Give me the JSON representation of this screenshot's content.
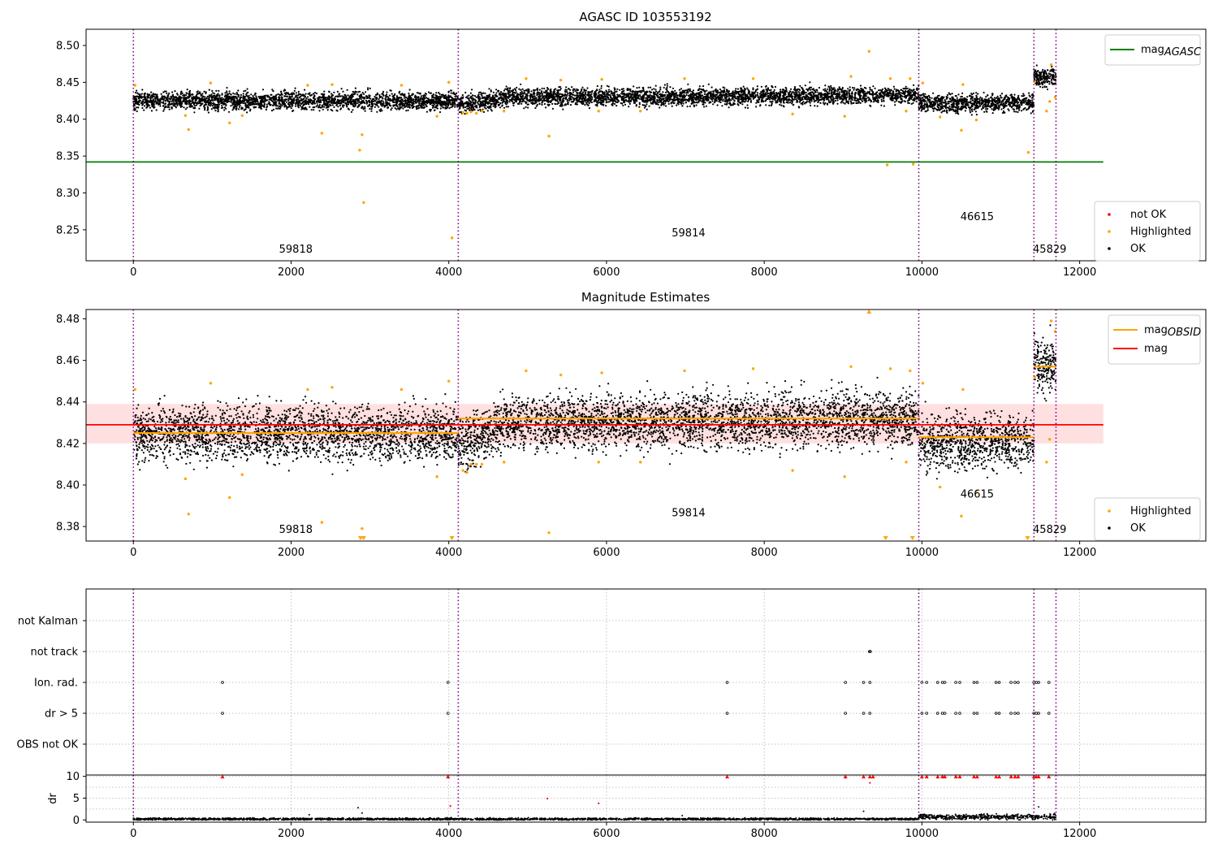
{
  "chart_data": [
    {
      "type": "scatter",
      "title": "AGASC ID 103553192",
      "xlim": [
        -600,
        13600
      ],
      "ylim": [
        8.208,
        8.522
      ],
      "xticks": [
        "0",
        "2000",
        "4000",
        "6000",
        "8000",
        "10000",
        "12000"
      ],
      "yticks": [
        "8.25",
        "8.30",
        "8.35",
        "8.40",
        "8.45",
        "8.50"
      ],
      "grid": false,
      "legend_top": {
        "placement": "top-right",
        "entries": [
          {
            "name": "mag",
            "sub": "AGASC",
            "color": "#008000"
          }
        ]
      },
      "legend_bottom": {
        "placement": "bottom-right",
        "entries": [
          {
            "name": "not OK",
            "color": "#ff0000"
          },
          {
            "name": "Highlighted",
            "color": "#ffa500"
          },
          {
            "name": "OK",
            "color": "#000000"
          }
        ]
      },
      "obsid_boundaries": [
        0,
        4120,
        9960,
        11420,
        11700
      ],
      "obsid_labels": [
        {
          "text": "59818",
          "x": 2060,
          "y": 8.219
        },
        {
          "text": "59814",
          "x": 7040,
          "y": 8.241
        },
        {
          "text": "46615",
          "x": 10700,
          "y": 8.263
        },
        {
          "text": "45829",
          "x": 11620,
          "y": 8.219
        }
      ],
      "mag_agasc": {
        "value": 8.342,
        "x_range": [
          -600,
          12300
        ]
      },
      "ok_segments": [
        {
          "x0": 0,
          "x1": 4120,
          "center": 8.425,
          "spread": 0.006,
          "slope": 0
        },
        {
          "x0": 4120,
          "x1": 4600,
          "center": 8.423,
          "spread": 0.006,
          "slope": 0.006
        },
        {
          "x0": 4600,
          "x1": 9960,
          "center": 8.431,
          "spread": 0.006,
          "slope": 0.003
        },
        {
          "x0": 9960,
          "x1": 11420,
          "center": 8.422,
          "spread": 0.006,
          "slope": 0
        },
        {
          "x0": 11420,
          "x1": 11700,
          "center": 8.457,
          "spread": 0.006,
          "slope": 0
        }
      ],
      "highlighted_points": [
        [
          20,
          8.446
        ],
        [
          660,
          8.405
        ],
        [
          700,
          8.386
        ],
        [
          980,
          8.449
        ],
        [
          1220,
          8.395
        ],
        [
          1380,
          8.405
        ],
        [
          2210,
          8.446
        ],
        [
          2390,
          8.381
        ],
        [
          2520,
          8.447
        ],
        [
          2870,
          8.358
        ],
        [
          2900,
          8.379
        ],
        [
          2920,
          8.287
        ],
        [
          3400,
          8.446
        ],
        [
          3850,
          8.404
        ],
        [
          4000,
          8.45
        ],
        [
          4040,
          8.239
        ],
        [
          4180,
          8.409
        ],
        [
          4230,
          8.408
        ],
        [
          4280,
          8.41
        ],
        [
          4350,
          8.408
        ],
        [
          4420,
          8.411
        ],
        [
          4700,
          8.411
        ],
        [
          4980,
          8.455
        ],
        [
          5270,
          8.377
        ],
        [
          5420,
          8.453
        ],
        [
          5900,
          8.411
        ],
        [
          5940,
          8.454
        ],
        [
          6430,
          8.411
        ],
        [
          6990,
          8.455
        ],
        [
          7860,
          8.455
        ],
        [
          8360,
          8.407
        ],
        [
          9020,
          8.404
        ],
        [
          9100,
          8.458
        ],
        [
          9330,
          8.492
        ],
        [
          9560,
          8.338
        ],
        [
          9600,
          8.455
        ],
        [
          9800,
          8.411
        ],
        [
          9850,
          8.455
        ],
        [
          9890,
          8.339
        ],
        [
          10010,
          8.449
        ],
        [
          10230,
          8.403
        ],
        [
          10500,
          8.385
        ],
        [
          10520,
          8.447
        ],
        [
          10690,
          8.399
        ],
        [
          11350,
          8.355
        ],
        [
          11430,
          8.451
        ],
        [
          11580,
          8.411
        ],
        [
          11620,
          8.424
        ],
        [
          11640,
          8.474
        ],
        [
          11690,
          8.43
        ]
      ]
    },
    {
      "type": "scatter",
      "title": "Magnitude Estimates",
      "xlim": [
        -600,
        13600
      ],
      "ylim": [
        8.373,
        8.4845
      ],
      "xticks": [
        "0",
        "2000",
        "4000",
        "6000",
        "8000",
        "10000",
        "12000"
      ],
      "yticks": [
        "8.38",
        "8.40",
        "8.42",
        "8.44",
        "8.46",
        "8.48"
      ],
      "grid": false,
      "legend_top": {
        "placement": "top-right",
        "entries": [
          {
            "name": "mag",
            "sub": "OBSID",
            "color": "#ffa500"
          },
          {
            "name": "mag",
            "sub": "",
            "color": "#ff0000"
          }
        ]
      },
      "legend_bottom": {
        "placement": "bottom-right",
        "entries": [
          {
            "name": "Highlighted",
            "color": "#ffa500"
          },
          {
            "name": "OK",
            "color": "#000000"
          }
        ]
      },
      "obsid_boundaries": [
        0,
        4120,
        9960,
        11420,
        11700
      ],
      "obsid_labels": [
        {
          "text": "59818",
          "x": 2060,
          "y": 8.377
        },
        {
          "text": "59814",
          "x": 7040,
          "y": 8.385
        },
        {
          "text": "46615",
          "x": 10700,
          "y": 8.394
        },
        {
          "text": "45829",
          "x": 11620,
          "y": 8.377
        }
      ],
      "mag": {
        "value": 8.429,
        "band": [
          8.42,
          8.439
        ],
        "x_range": [
          -600,
          12300
        ]
      },
      "mag_obsid": [
        {
          "x0": 0,
          "x1": 4120,
          "value": 8.425
        },
        {
          "x0": 4120,
          "x1": 9960,
          "value": 8.432
        },
        {
          "x0": 9960,
          "x1": 11420,
          "value": 8.423
        },
        {
          "x0": 11420,
          "x1": 11700,
          "value": 8.457
        }
      ],
      "ok_segments": [
        {
          "x0": 0,
          "x1": 4120,
          "center": 8.425,
          "spread": 0.0065,
          "slope": 0
        },
        {
          "x0": 4120,
          "x1": 4600,
          "center": 8.423,
          "spread": 0.0065,
          "slope": 0.006
        },
        {
          "x0": 4600,
          "x1": 9960,
          "center": 8.431,
          "spread": 0.0065,
          "slope": 0.003
        },
        {
          "x0": 9960,
          "x1": 11420,
          "center": 8.421,
          "spread": 0.0065,
          "slope": 0
        },
        {
          "x0": 11420,
          "x1": 11700,
          "center": 8.457,
          "spread": 0.0065,
          "slope": 0
        }
      ],
      "highlighted_points": [
        [
          20,
          8.446
        ],
        [
          660,
          8.403
        ],
        [
          700,
          8.386
        ],
        [
          980,
          8.449
        ],
        [
          1220,
          8.394
        ],
        [
          1380,
          8.405
        ],
        [
          2210,
          8.446
        ],
        [
          2390,
          8.382
        ],
        [
          2520,
          8.447
        ],
        [
          2900,
          8.379
        ],
        [
          3400,
          8.446
        ],
        [
          3850,
          8.404
        ],
        [
          4000,
          8.45
        ],
        [
          4180,
          8.407
        ],
        [
          4230,
          8.406
        ],
        [
          4280,
          8.41
        ],
        [
          4350,
          8.41
        ],
        [
          4420,
          8.41
        ],
        [
          4700,
          8.411
        ],
        [
          4980,
          8.455
        ],
        [
          5270,
          8.377
        ],
        [
          5420,
          8.453
        ],
        [
          5900,
          8.411
        ],
        [
          5940,
          8.454
        ],
        [
          6430,
          8.411
        ],
        [
          6990,
          8.455
        ],
        [
          7860,
          8.456
        ],
        [
          8360,
          8.407
        ],
        [
          9020,
          8.404
        ],
        [
          9100,
          8.457
        ],
        [
          9600,
          8.456
        ],
        [
          9800,
          8.411
        ],
        [
          9850,
          8.455
        ],
        [
          10010,
          8.449
        ],
        [
          10230,
          8.399
        ],
        [
          10500,
          8.385
        ],
        [
          10520,
          8.446
        ],
        [
          10690,
          8.397
        ],
        [
          11430,
          8.452
        ],
        [
          11580,
          8.411
        ],
        [
          11620,
          8.422
        ],
        [
          11640,
          8.479
        ],
        [
          11690,
          8.474
        ]
      ],
      "clipped_low_x": [
        2880,
        2920,
        4040,
        9540,
        9880,
        11340
      ],
      "clipped_high_x": [
        9330
      ]
    },
    {
      "type": "scatter",
      "title": "",
      "xlim": [
        -600,
        13600
      ],
      "xticks": [
        "0",
        "2000",
        "4000",
        "6000",
        "8000",
        "10000",
        "12000"
      ],
      "flag_rows": [
        "not Kalman",
        "not track",
        "Ion. rad.",
        "dr > 5",
        "OBS not OK"
      ],
      "obsid_boundaries": [
        0,
        4120,
        9960,
        11420,
        11700
      ],
      "flags": {
        "not track": [
          9335,
          9345
        ],
        "Ion. rad.": [
          1130,
          3990,
          7530,
          9030,
          9260,
          9340,
          10000,
          10060,
          10200,
          10260,
          10290,
          10430,
          10480,
          10660,
          10700,
          10940,
          10980,
          11130,
          11180,
          11220,
          11420,
          11450,
          11480,
          11610
        ],
        "dr > 5": [
          1130,
          3990,
          7530,
          9030,
          9260,
          9340,
          10000,
          10060,
          10200,
          10260,
          10290,
          10430,
          10480,
          10660,
          10700,
          10940,
          10980,
          11130,
          11180,
          11220,
          11420,
          11450,
          11480,
          11610
        ]
      }
    },
    {
      "type": "scatter",
      "title": "",
      "ylabel": "dr",
      "xlim": [
        -600,
        13600
      ],
      "ylim": [
        -0.5,
        10.3
      ],
      "xticks": [
        "0",
        "2000",
        "4000",
        "6000",
        "8000",
        "10000",
        "12000"
      ],
      "yticks": [
        "0",
        "5",
        "10"
      ],
      "obsid_boundaries": [
        0,
        4120,
        9960,
        11420,
        11700
      ],
      "ok_segments": [
        {
          "x0": 0,
          "x1": 9960,
          "center": 0.2,
          "spread": 0.12
        },
        {
          "x0": 9960,
          "x1": 11700,
          "center": 0.7,
          "spread": 0.3
        }
      ],
      "clipped_dr_x": [
        1130,
        3990,
        7530,
        9030,
        9260,
        9340,
        9380,
        10000,
        10060,
        10200,
        10260,
        10290,
        10430,
        10480,
        10660,
        10700,
        10940,
        10980,
        11130,
        11180,
        11220,
        11420,
        11450,
        11480,
        11610
      ],
      "outlier_red": [
        [
          4020,
          3.2
        ],
        [
          5250,
          4.9
        ],
        [
          5900,
          3.8
        ],
        [
          9340,
          8.5
        ]
      ],
      "outlier_black": [
        [
          2230,
          1.2
        ],
        [
          2850,
          2.8
        ],
        [
          2900,
          1.6
        ],
        [
          6960,
          1.0
        ],
        [
          9260,
          2.0
        ],
        [
          11480,
          3.0
        ],
        [
          11680,
          1.5
        ]
      ]
    }
  ]
}
